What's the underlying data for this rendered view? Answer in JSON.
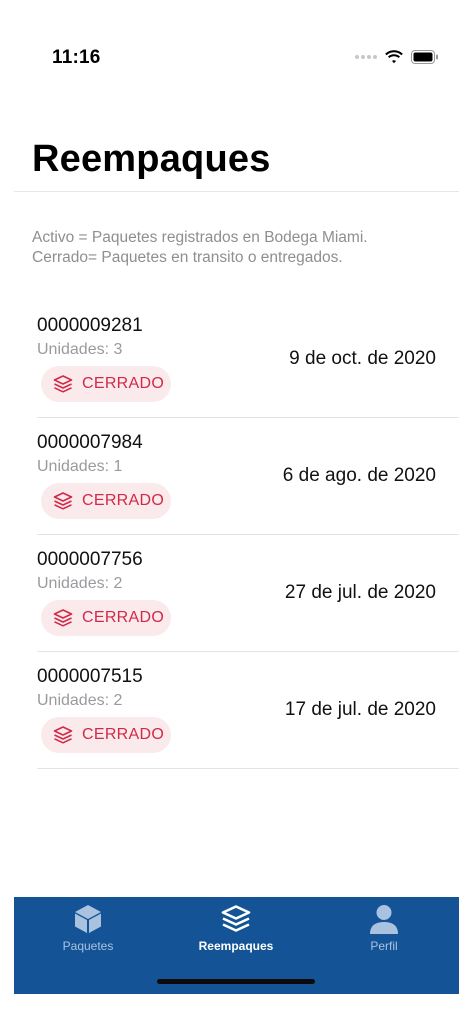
{
  "status_bar": {
    "time": "11:16"
  },
  "header": {
    "title": "Reempaques"
  },
  "legend": {
    "line1": "Activo = Paquetes registrados en Bodega Miami.",
    "line2": "Cerrado= Paquetes en transito o entregados."
  },
  "reempaques": [
    {
      "id": "0000009281",
      "units": "Unidades: 3",
      "status": "CERRADO",
      "date": "9 de oct. de 2020"
    },
    {
      "id": "0000007984",
      "units": "Unidades: 1",
      "status": "CERRADO",
      "date": "6 de ago. de 2020"
    },
    {
      "id": "0000007756",
      "units": "Unidades: 2",
      "status": "CERRADO",
      "date": "27 de jul. de 2020"
    },
    {
      "id": "0000007515",
      "units": "Unidades: 2",
      "status": "CERRADO",
      "date": "17 de jul. de 2020"
    }
  ],
  "tab_bar": {
    "tabs": [
      {
        "label": "Paquetes",
        "icon": "box-icon",
        "active": false
      },
      {
        "label": "Reempaques",
        "icon": "layers-icon",
        "active": true
      },
      {
        "label": "Perfil",
        "icon": "user-icon",
        "active": false
      }
    ]
  },
  "colors": {
    "brand": "#145496",
    "status_closed_text": "#d02a48",
    "status_closed_bg": "#fbeaec",
    "muted_text": "#8e8e93"
  }
}
